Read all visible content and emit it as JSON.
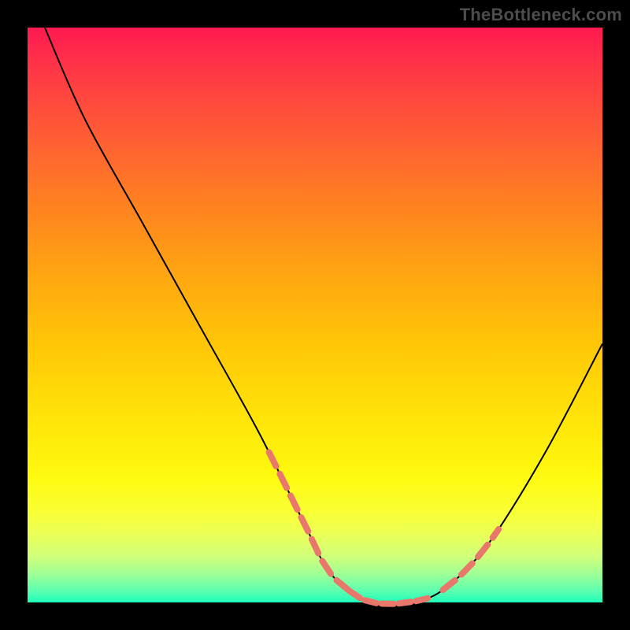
{
  "attribution": "TheBottleneck.com",
  "chart_data": {
    "type": "line",
    "title": "",
    "xlabel": "",
    "ylabel": "",
    "xlim": [
      0,
      100
    ],
    "ylim": [
      0,
      100
    ],
    "grid": false,
    "series": [
      {
        "name": "curve",
        "x": [
          3,
          10,
          20,
          30,
          40,
          48,
          52,
          56,
          60,
          66,
          72,
          80,
          90,
          100
        ],
        "values": [
          100,
          84,
          66,
          48,
          30,
          14,
          6,
          2,
          0,
          0,
          2,
          10,
          26,
          45
        ]
      }
    ],
    "marker_band": {
      "left": {
        "x_start": 42,
        "x_end": 56
      },
      "right": {
        "x_start": 72,
        "x_end": 82
      }
    },
    "colors": {
      "curve": "#000000",
      "marker": "#e8786b",
      "gradient_top": "#ff1a51",
      "gradient_bottom": "#1dffba",
      "background": "#000000"
    }
  }
}
